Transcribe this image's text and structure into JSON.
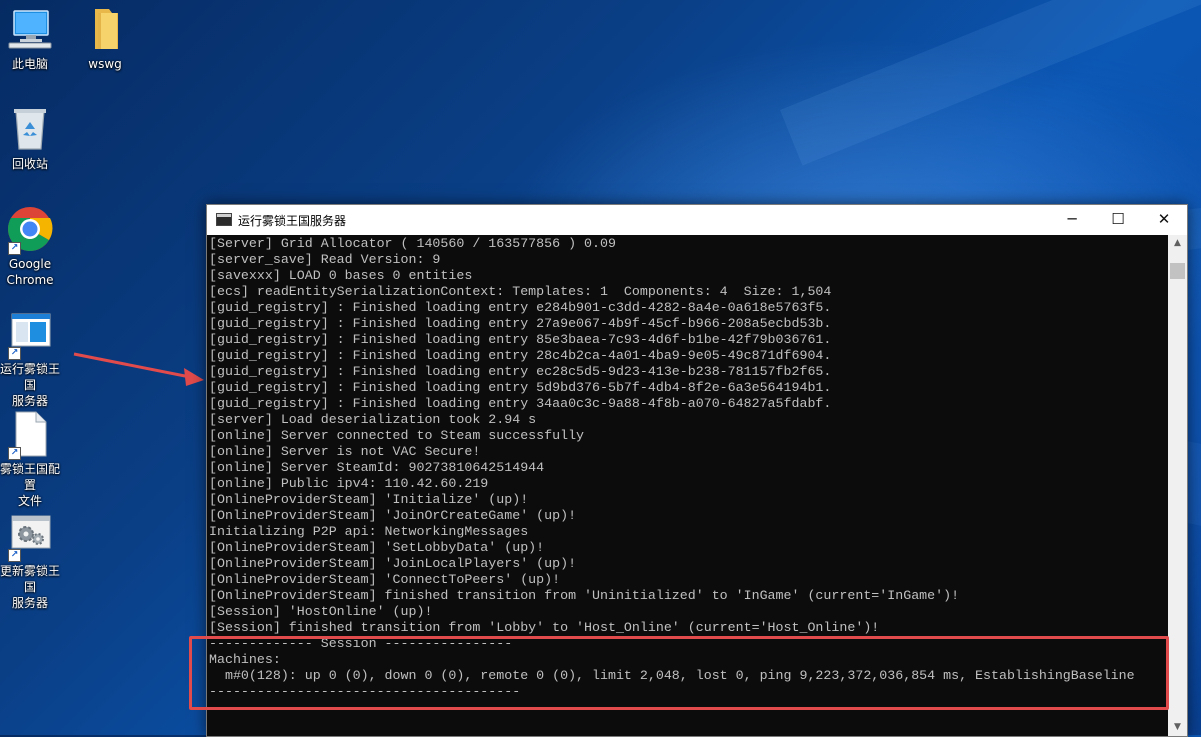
{
  "desktop": {
    "icons": [
      {
        "label": "此电脑"
      },
      {
        "label": "wswg"
      },
      {
        "label": "回收站"
      },
      {
        "label": "Google\nChrome"
      },
      {
        "label": "运行雾锁王国\n服务器"
      },
      {
        "label": "雾锁王国配置\n文件"
      },
      {
        "label": "更新雾锁王国\n服务器"
      }
    ]
  },
  "window": {
    "title": "运行雾锁王国服务器",
    "minimize": "─",
    "maximize": "☐",
    "close": "✕"
  },
  "console": {
    "lines": [
      "[Server] Grid Allocator ( 140560 / 163577856 ) 0.09",
      "[server_save] Read Version: 9",
      "[savexxx] LOAD 0 bases 0 entities",
      "[ecs] readEntitySerializationContext: Templates: 1  Components: 4  Size: 1,504",
      "[guid_registry] : Finished loading entry e284b901-c3dd-4282-8a4e-0a618e5763f5.",
      "[guid_registry] : Finished loading entry 27a9e067-4b9f-45cf-b966-208a5ecbd53b.",
      "[guid_registry] : Finished loading entry 85e3baea-7c93-4d6f-b1be-42f79b036761.",
      "[guid_registry] : Finished loading entry 28c4b2ca-4a01-4ba9-9e05-49c871df6904.",
      "[guid_registry] : Finished loading entry ec28c5d5-9d23-413e-b238-781157fb2f65.",
      "[guid_registry] : Finished loading entry 5d9bd376-5b7f-4db4-8f2e-6a3e564194b1.",
      "[guid_registry] : Finished loading entry 34aa0c3c-9a88-4f8b-a070-64827a5fdabf.",
      "[server] Load deserialization took 2.94 s",
      "[online] Server connected to Steam successfully",
      "[online] Server is not VAC Secure!",
      "[online] Server SteamId: 90273810642514944",
      "[online] Public ipv4: 110.42.60.219",
      "[OnlineProviderSteam] 'Initialize' (up)!",
      "[OnlineProviderSteam] 'JoinOrCreateGame' (up)!",
      "Initializing P2P api: NetworkingMessages",
      "[OnlineProviderSteam] 'SetLobbyData' (up)!",
      "[OnlineProviderSteam] 'JoinLocalPlayers' (up)!",
      "[OnlineProviderSteam] 'ConnectToPeers' (up)!",
      "[OnlineProviderSteam] finished transition from 'Uninitialized' to 'InGame' (current='InGame')!",
      "[Session] 'HostOnline' (up)!",
      "[Session] finished transition from 'Lobby' to 'Host_Online' (current='Host_Online')!",
      "------------- Session ----------------",
      "Machines:",
      "  m#0(128): up 0 (0), down 0 (0), remote 0 (0), limit 2,048, lost 0, ping 9,223,372,036,854 ms, EstablishingBaseline",
      "---------------------------------------"
    ]
  },
  "colors": {
    "highlight": "#e24b4b",
    "console_bg": "#0c0c0c",
    "console_text": "#c0c0c0"
  }
}
